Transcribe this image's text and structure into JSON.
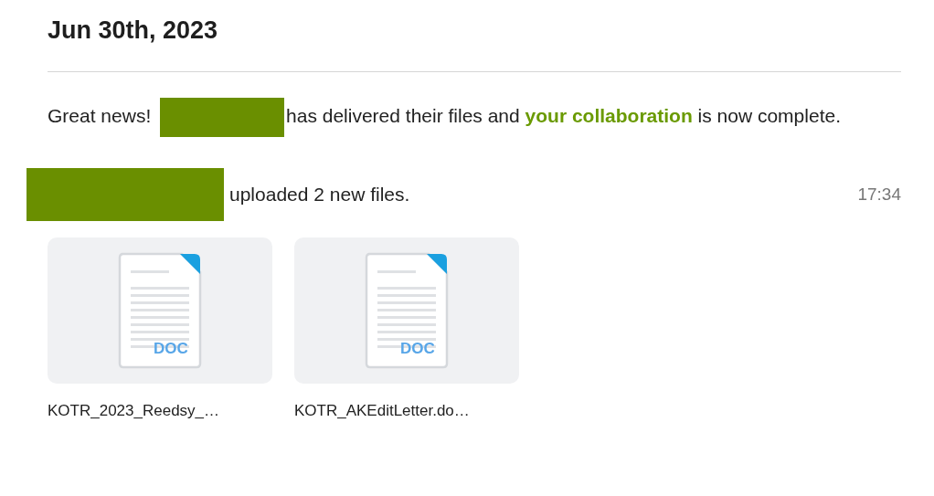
{
  "date": "Jun 30th, 2023",
  "message": {
    "before": "Great news!",
    "after": "has delivered their files and",
    "link": "your collaboration",
    "end": "is now complete."
  },
  "upload": {
    "text": "uploaded 2 new files.",
    "time": "17:34"
  },
  "files": [
    {
      "name": "KOTR_2023_Reedsy_…",
      "type": "DOC"
    },
    {
      "name": "KOTR_AKEditLetter.do…",
      "type": "DOC"
    }
  ]
}
